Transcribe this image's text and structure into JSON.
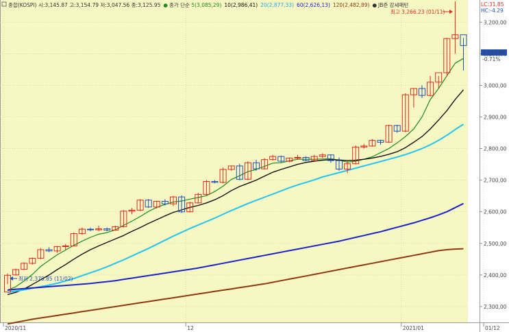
{
  "header": {
    "name": "종합(KOSPI)",
    "ohlc": " 시:3,145.87 고:3,154.79 저:3,047.56 종:3,125.95",
    "ma_title": "종가 단순 ",
    "pattern_label": "JB준 강세패턴",
    "lc": "LC:31.85",
    "hc": "HC:-4.29"
  },
  "colors": {
    "background": "#f7f7c4",
    "up_candle": "#e0281c",
    "down_candle": "#1e50b8",
    "ma5": "#1c8c1c",
    "ma10": "#111111",
    "ma20": "#22c4f0",
    "ma60": "#1a22c8",
    "ma120": "#8b3a10"
  },
  "chart_data": {
    "type": "candlestick",
    "ylim": [
      2250,
      3270
    ],
    "yticks": [
      2300,
      2400,
      2500,
      2600,
      2700,
      2800,
      2900,
      3000,
      3100,
      3200
    ],
    "ytick_labels": [
      "2,300,00",
      "2,400,00",
      "2,500,00",
      "2,600,00",
      "2,700,00",
      "2,800,00",
      "2,900,00",
      "3,000,00",
      "3,100,00",
      "3,200,00"
    ],
    "xlabels": [
      {
        "index": 0,
        "label": "2020/11"
      },
      {
        "index": 22,
        "label": "12"
      },
      {
        "index": 48,
        "label": "2021/01"
      },
      {
        "index": 58,
        "label": "01/12"
      }
    ],
    "last_price": "3,125.95",
    "last_change": "-0.71%",
    "max_annotation": "최고 3,266.23 (01/11)",
    "min_annotation": "최저 2,370.85 (11/02)",
    "candles": [
      [
        2346,
        2405,
        2371,
        2399
      ],
      [
        2400,
        2420,
        2398,
        2417
      ],
      [
        2418,
        2440,
        2416,
        2437
      ],
      [
        2437,
        2455,
        2433,
        2453
      ],
      [
        2453,
        2485,
        2450,
        2480
      ],
      [
        2480,
        2488,
        2472,
        2476
      ],
      [
        2476,
        2492,
        2470,
        2490
      ],
      [
        2490,
        2498,
        2480,
        2492
      ],
      [
        2492,
        2535,
        2490,
        2531
      ],
      [
        2531,
        2550,
        2527,
        2545
      ],
      [
        2545,
        2550,
        2538,
        2543
      ],
      [
        2543,
        2556,
        2538,
        2546
      ],
      [
        2546,
        2550,
        2538,
        2542
      ],
      [
        2542,
        2556,
        2540,
        2553
      ],
      [
        2553,
        2605,
        2550,
        2602
      ],
      [
        2602,
        2612,
        2592,
        2605
      ],
      [
        2605,
        2640,
        2602,
        2637
      ],
      [
        2637,
        2640,
        2612,
        2615
      ],
      [
        2615,
        2635,
        2610,
        2633
      ],
      [
        2633,
        2640,
        2620,
        2625
      ],
      [
        2625,
        2650,
        2618,
        2647
      ],
      [
        2647,
        2652,
        2596,
        2600
      ],
      [
        2600,
        2632,
        2598,
        2628
      ],
      [
        2628,
        2660,
        2626,
        2655
      ],
      [
        2655,
        2700,
        2652,
        2696
      ],
      [
        2696,
        2700,
        2690,
        2693
      ],
      [
        2693,
        2740,
        2690,
        2734
      ],
      [
        2734,
        2746,
        2730,
        2745
      ],
      [
        2745,
        2752,
        2700,
        2703
      ],
      [
        2703,
        2760,
        2700,
        2755
      ],
      [
        2755,
        2765,
        2730,
        2736
      ],
      [
        2736,
        2770,
        2734,
        2765
      ],
      [
        2765,
        2780,
        2762,
        2775
      ],
      [
        2775,
        2778,
        2755,
        2760
      ],
      [
        2760,
        2772,
        2757,
        2770
      ],
      [
        2770,
        2780,
        2765,
        2772
      ],
      [
        2772,
        2775,
        2760,
        2762
      ],
      [
        2762,
        2780,
        2760,
        2775
      ],
      [
        2775,
        2785,
        2770,
        2780
      ],
      [
        2780,
        2782,
        2755,
        2762
      ],
      [
        2762,
        2772,
        2730,
        2735
      ],
      [
        2735,
        2760,
        2722,
        2752
      ],
      [
        2752,
        2810,
        2750,
        2805
      ],
      [
        2805,
        2815,
        2800,
        2808
      ],
      [
        2808,
        2830,
        2806,
        2826
      ],
      [
        2826,
        2828,
        2812,
        2820
      ],
      [
        2820,
        2875,
        2818,
        2873
      ],
      [
        2873,
        2875,
        2850,
        2855
      ],
      [
        2855,
        2975,
        2852,
        2970
      ],
      [
        2970,
        2990,
        2930,
        2990
      ],
      [
        2990,
        3000,
        2960,
        2968
      ],
      [
        2968,
        3030,
        2965,
        3010
      ],
      [
        3010,
        3030,
        2990,
        3040
      ],
      [
        3040,
        3150,
        3030,
        3148
      ],
      [
        3148,
        3266,
        3100,
        3160
      ],
      [
        3160,
        3150,
        3047,
        3126
      ]
    ],
    "series": [
      {
        "name": "5",
        "value_label": "3,085,29",
        "values": [
          2352,
          2363,
          2381,
          2402,
          2427,
          2446,
          2464,
          2479,
          2494,
          2507,
          2519,
          2529,
          2534,
          2543,
          2557,
          2570,
          2585,
          2601,
          2614,
          2623,
          2631,
          2634,
          2640,
          2645,
          2651,
          2664,
          2681,
          2702,
          2714,
          2727,
          2734,
          2744,
          2754,
          2755,
          2761,
          2766,
          2766,
          2766,
          2767,
          2768,
          2763,
          2757,
          2760,
          2766,
          2774,
          2787,
          2800,
          2818,
          2838,
          2862,
          2900,
          2955,
          2990,
          3030,
          3070,
          3085
        ]
      },
      {
        "name": "10",
        "value_label": "2,986,41",
        "values": [
          2338,
          2345,
          2356,
          2370,
          2385,
          2400,
          2417,
          2433,
          2450,
          2466,
          2480,
          2492,
          2503,
          2514,
          2525,
          2538,
          2550,
          2563,
          2575,
          2587,
          2598,
          2606,
          2614,
          2620,
          2628,
          2638,
          2651,
          2667,
          2680,
          2690,
          2700,
          2713,
          2725,
          2734,
          2742,
          2750,
          2756,
          2760,
          2763,
          2765,
          2764,
          2762,
          2763,
          2766,
          2770,
          2775,
          2782,
          2790,
          2803,
          2820,
          2838,
          2862,
          2890,
          2920,
          2955,
          2986
        ]
      },
      {
        "name": "20",
        "value_label": "2,877,33",
        "values": [
          2345,
          2349,
          2353,
          2358,
          2363,
          2368,
          2374,
          2381,
          2389,
          2398,
          2407,
          2416,
          2426,
          2437,
          2448,
          2460,
          2472,
          2484,
          2497,
          2510,
          2523,
          2535,
          2547,
          2558,
          2569,
          2580,
          2592,
          2604,
          2615,
          2626,
          2636,
          2646,
          2656,
          2666,
          2676,
          2685,
          2693,
          2701,
          2710,
          2717,
          2724,
          2731,
          2738,
          2745,
          2752,
          2759,
          2766,
          2773,
          2781,
          2790,
          2800,
          2812,
          2826,
          2842,
          2860,
          2877
        ]
      },
      {
        "name": "60",
        "value_label": "2,626,13",
        "values": [
          2352,
          2355,
          2357,
          2359,
          2361,
          2363,
          2365,
          2367,
          2369,
          2371,
          2373,
          2376,
          2379,
          2382,
          2386,
          2390,
          2394,
          2398,
          2402,
          2406,
          2410,
          2414,
          2418,
          2422,
          2427,
          2432,
          2437,
          2442,
          2447,
          2452,
          2457,
          2462,
          2467,
          2472,
          2477,
          2482,
          2487,
          2492,
          2497,
          2502,
          2507,
          2513,
          2519,
          2525,
          2531,
          2537,
          2544,
          2551,
          2558,
          2565,
          2573,
          2581,
          2590,
          2600,
          2613,
          2626
        ]
      },
      {
        "name": "120",
        "value_label": "2,482,89",
        "values": [
          2245,
          2250,
          2255,
          2260,
          2264,
          2268,
          2272,
          2276,
          2280,
          2284,
          2288,
          2292,
          2296,
          2300,
          2304,
          2308,
          2312,
          2316,
          2320,
          2324,
          2328,
          2332,
          2336,
          2340,
          2344,
          2348,
          2352,
          2356,
          2360,
          2364,
          2368,
          2372,
          2377,
          2382,
          2387,
          2392,
          2397,
          2402,
          2407,
          2412,
          2417,
          2422,
          2427,
          2432,
          2437,
          2442,
          2447,
          2452,
          2457,
          2462,
          2467,
          2472,
          2477,
          2480,
          2482,
          2483
        ]
      }
    ]
  }
}
